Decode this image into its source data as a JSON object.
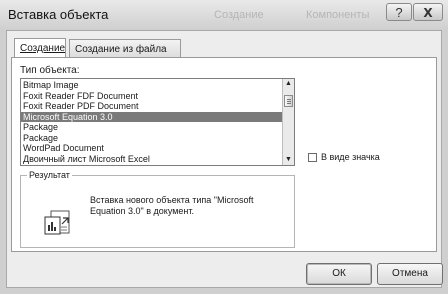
{
  "window": {
    "title": "Вставка объекта",
    "ghost_left": "Создание",
    "ghost_right": "Компоненты",
    "help_symbol": "?",
    "close_symbol": "X"
  },
  "tabs": [
    {
      "label": "Создание"
    },
    {
      "label": "Создание из файла"
    }
  ],
  "object_type": {
    "label": "Тип объекта:",
    "items": [
      "Bitmap Image",
      "Foxit Reader FDF Document",
      "Foxit Reader PDF Document",
      "Microsoft Equation 3.0",
      "Package",
      "Package",
      "WordPad Document",
      "Двоичный лист Microsoft Excel"
    ],
    "selected_index": 3
  },
  "as_icon": {
    "label": "В виде значка",
    "checked": false
  },
  "result": {
    "legend": "Результат",
    "text": "Вставка нового объекта типа \"Microsoft Equation 3.0\" в документ."
  },
  "buttons": {
    "ok": "ОК",
    "cancel": "Отмена"
  },
  "icons": {
    "help": "help-icon",
    "close": "close-icon",
    "scroll_up": "arrow-up-icon",
    "scroll_down": "arrow-down-icon",
    "result": "insert-object-icon"
  }
}
